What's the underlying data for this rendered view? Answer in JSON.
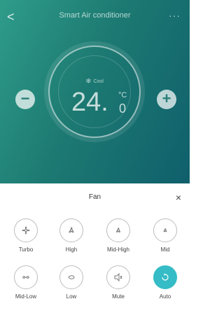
{
  "header": {
    "title": "Smart Air conditioner",
    "back_glyph": "<",
    "more_glyph": "···"
  },
  "thermostat": {
    "mode_icon": "snowflake-icon",
    "mode": "Cool",
    "temp_main": "24.",
    "temp_decimal": "0",
    "unit": "°C",
    "minus": "−",
    "plus": "+"
  },
  "fan_panel": {
    "title": "Fan",
    "close_glyph": "×",
    "options": [
      {
        "label": "Turbo",
        "icon": "fan-turbo-icon"
      },
      {
        "label": "High",
        "icon": "fan-high-icon"
      },
      {
        "label": "Mid-High",
        "icon": "fan-mid-high-icon"
      },
      {
        "label": "Mid",
        "icon": "fan-mid-icon"
      },
      {
        "label": "Mid-Low",
        "icon": "fan-mid-low-icon"
      },
      {
        "label": "Low",
        "icon": "fan-low-icon"
      },
      {
        "label": "Mute",
        "icon": "mute-icon"
      },
      {
        "label": "Auto",
        "icon": "auto-icon",
        "selected": true
      }
    ]
  },
  "colors": {
    "accent": "#35bcc6",
    "gradient_start": "#2f9c8a",
    "gradient_end": "#0f5f6b"
  }
}
